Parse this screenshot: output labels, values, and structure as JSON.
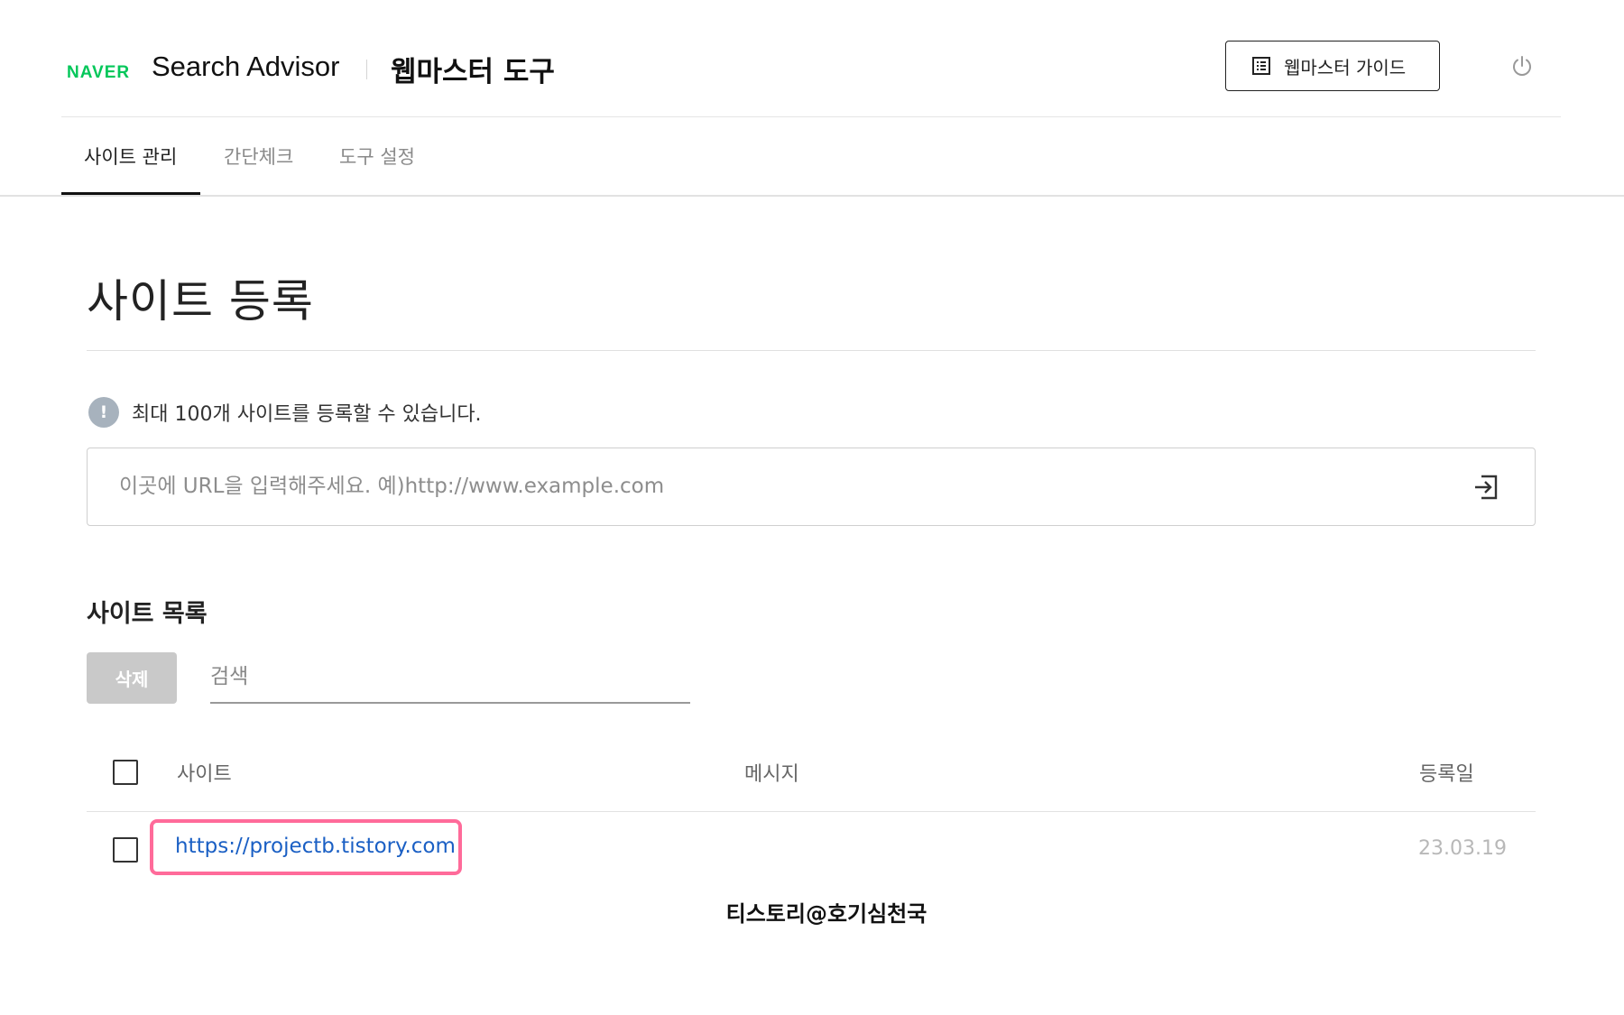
{
  "header": {
    "logo_text": "NAVER",
    "brand_title": "Search Advisor",
    "brand_subtitle": "웹마스터 도구",
    "guide_button_label": "웹마스터 가이드",
    "guide_icon": "document-list-icon",
    "power_icon": "power-icon"
  },
  "tabs": [
    {
      "label": "사이트 관리",
      "active": true
    },
    {
      "label": "간단체크",
      "active": false
    },
    {
      "label": "도구 설정",
      "active": false
    }
  ],
  "register": {
    "title": "사이트 등록",
    "info_icon": "exclamation-icon",
    "info_icon_glyph": "!",
    "info_text": "최대 100개 사이트를 등록할 수 있습니다.",
    "url_placeholder": "이곳에 URL을 입력해주세요. 예)http://www.example.com",
    "url_value": "",
    "submit_icon": "enter-icon"
  },
  "site_list": {
    "heading": "사이트 목록",
    "delete_button_label": "삭제",
    "search_placeholder": "검색",
    "columns": {
      "site": "사이트",
      "message": "메시지",
      "registered_date": "등록일"
    },
    "rows": [
      {
        "site": "https://projectb.tistory.com",
        "message": "",
        "registered_date": "23.03.19",
        "checked": false
      }
    ]
  },
  "watermark": "티스토리@호기심천국",
  "colors": {
    "naver_green": "#03c75a",
    "link_blue": "#1a5fc4",
    "highlight_pink": "#ff6b9a",
    "disabled_button_gray": "#c9c9c9",
    "info_icon_gray": "#a7b2bd"
  }
}
